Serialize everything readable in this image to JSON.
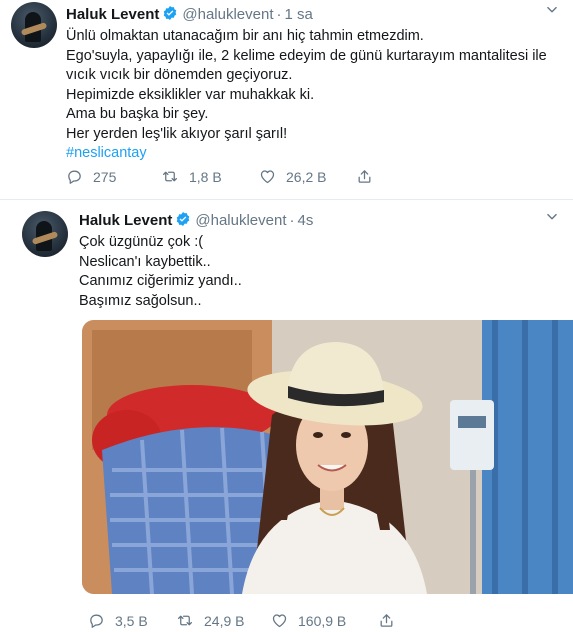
{
  "colors": {
    "link": "#1da1f2",
    "muted": "#657786",
    "text": "#14171a",
    "verified": "#1da1f2"
  },
  "tweets": [
    {
      "name": "Haluk Levent",
      "handle": "@haluklevent",
      "separator": "·",
      "time": "1 sa",
      "lines": [
        "Ünlü olmaktan utanacağım bir anı hiç tahmin etmezdim.",
        "Ego'suyla, yapaylığı ile, 2 kelime edeyim de günü kurtarayım mantalitesi ile",
        "vıcık vıcık bir dönemden geçiyoruz.",
        "Hepimizde eksiklikler var muhakkak ki.",
        "Ama bu başka bir şey.",
        "Her yerden leş'lik akıyor şarıl şarıl!"
      ],
      "hashtag": "#neslicantay",
      "replies": "275",
      "retweets": "1,8 B",
      "likes": "26,2 B"
    },
    {
      "name": "Haluk Levent",
      "handle": "@haluklevent",
      "separator": "·",
      "time": "4s",
      "lines": [
        "Çok üzgünüz çok :(",
        "Neslican'ı kaybettik..",
        "Canımız ciğerimiz yandı..",
        "Başımız sağolsun.."
      ],
      "replies": "3,5 B",
      "retweets": "24,9 B",
      "likes": "160,9 B"
    }
  ],
  "icons": {
    "reply": "reply-icon",
    "retweet": "retweet-icon",
    "like": "heart-icon",
    "share": "share-icon",
    "verified": "verified-badge-icon",
    "caret": "chevron-down-icon"
  }
}
